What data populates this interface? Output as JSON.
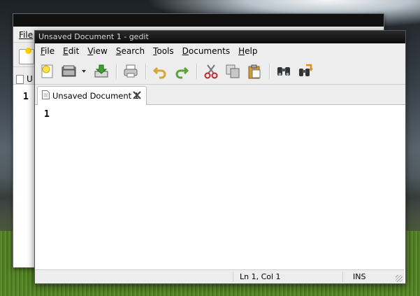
{
  "background_window": {
    "menu_first": "File",
    "tab_label_fragment": "U",
    "line_number": "1"
  },
  "window": {
    "title": "Unsaved Document 1 - gedit"
  },
  "menubar": {
    "items": [
      {
        "ul": "F",
        "rest": "ile"
      },
      {
        "ul": "E",
        "rest": "dit"
      },
      {
        "ul": "V",
        "rest": "iew"
      },
      {
        "ul": "S",
        "rest": "earch"
      },
      {
        "ul": "T",
        "rest": "ools"
      },
      {
        "ul": "D",
        "rest": "ocuments"
      },
      {
        "ul": "H",
        "rest": "elp"
      }
    ]
  },
  "toolbar": {
    "icons": [
      "new-document-icon",
      "open-folder-icon",
      "open-recent-dropdown-icon",
      "save-icon",
      "print-icon",
      "undo-icon",
      "redo-icon",
      "cut-icon",
      "copy-icon",
      "paste-icon",
      "find-icon",
      "find-replace-icon"
    ]
  },
  "tabs": [
    {
      "label": "Unsaved Document 1"
    }
  ],
  "editor": {
    "line_number": "1",
    "content": ""
  },
  "statusbar": {
    "position": "Ln 1, Col 1",
    "mode": "INS"
  }
}
